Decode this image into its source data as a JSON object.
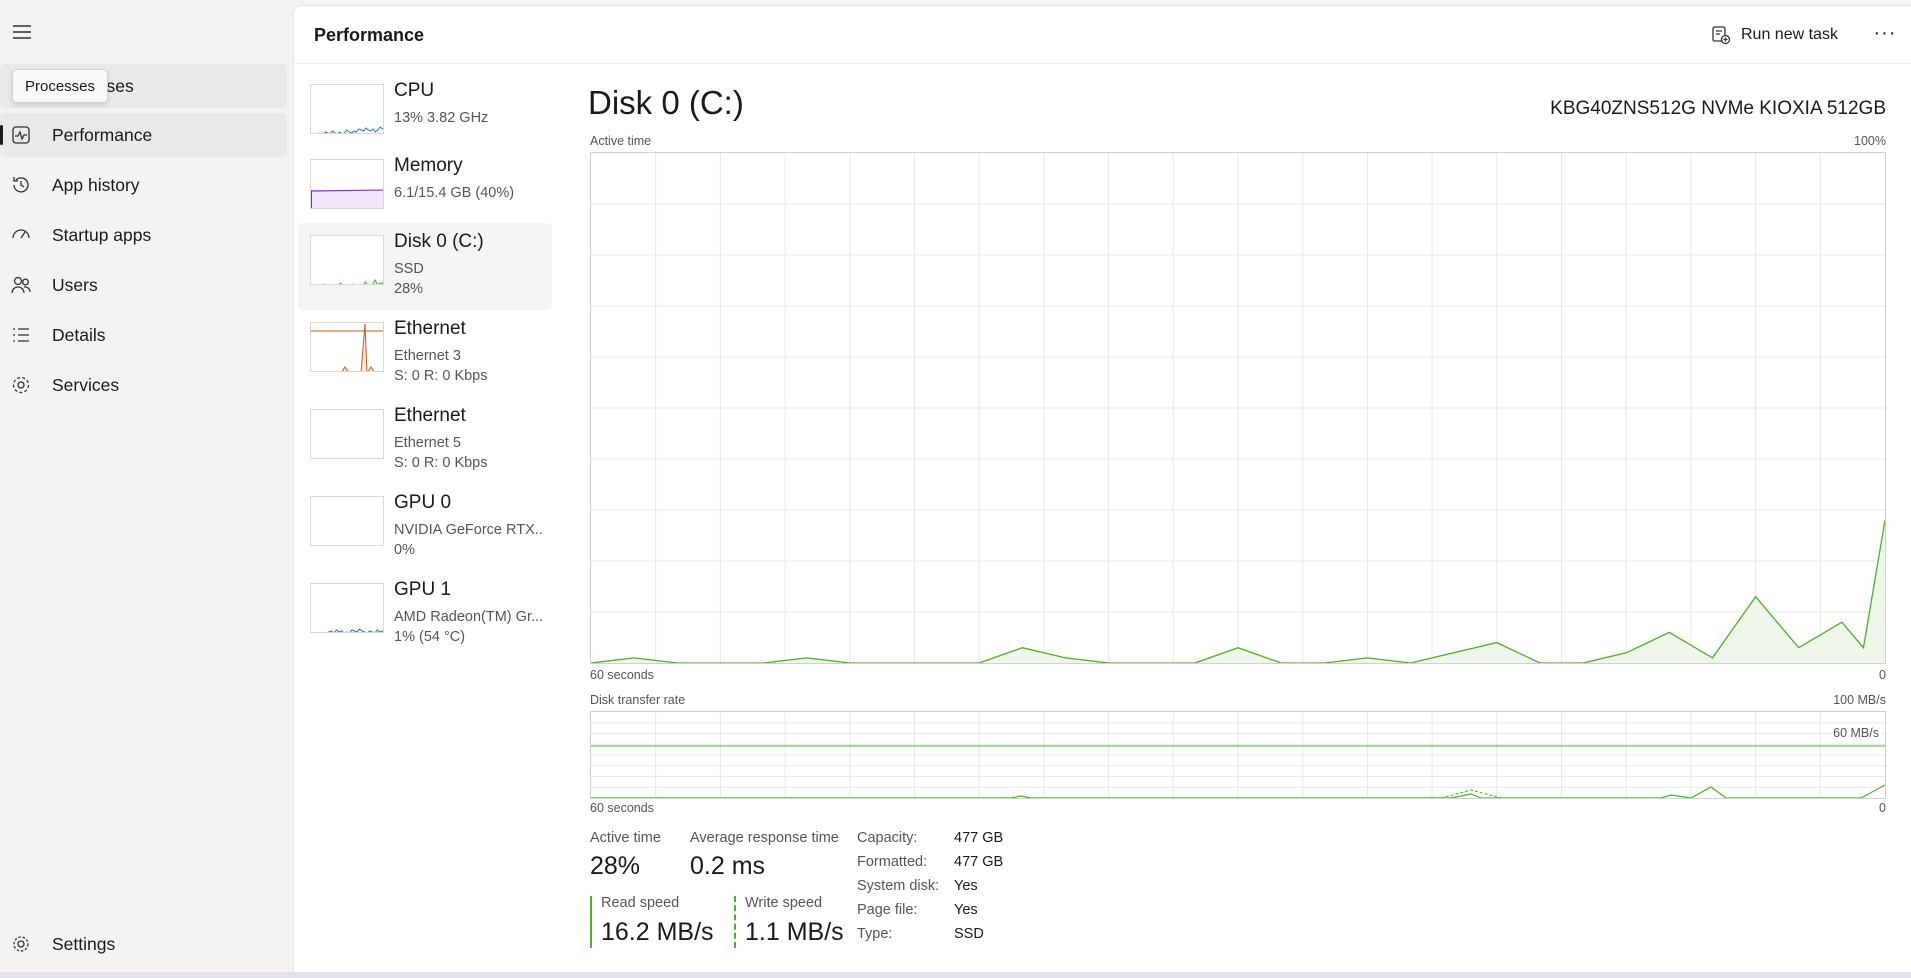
{
  "nav": {
    "tooltip": "Processes",
    "items": [
      {
        "label": "Processes",
        "icon": "processes-icon"
      },
      {
        "label": "Performance",
        "icon": "performance-icon"
      },
      {
        "label": "App history",
        "icon": "history-icon"
      },
      {
        "label": "Startup apps",
        "icon": "startup-icon"
      },
      {
        "label": "Users",
        "icon": "users-icon"
      },
      {
        "label": "Details",
        "icon": "details-icon"
      },
      {
        "label": "Services",
        "icon": "services-icon"
      }
    ],
    "settings": "Settings"
  },
  "header": {
    "title": "Performance",
    "run_task": "Run new task",
    "more": "···"
  },
  "devices": [
    {
      "name": "CPU",
      "sub1": "13%  3.82 GHz",
      "sub2": "",
      "color": "#1f78c8"
    },
    {
      "name": "Memory",
      "sub1": "6.1/15.4 GB (40%)",
      "sub2": "",
      "color": "#8a2be2"
    },
    {
      "name": "Disk 0 (C:)",
      "sub1": "SSD",
      "sub2": "28%",
      "color": "#4caf2a"
    },
    {
      "name": "Ethernet",
      "sub1": "Ethernet 3",
      "sub2": "S: 0  R: 0 Kbps",
      "color": "#c85a19"
    },
    {
      "name": "Ethernet",
      "sub1": "Ethernet 5",
      "sub2": "S: 0  R: 0 Kbps",
      "color": "#c85a19"
    },
    {
      "name": "GPU 0",
      "sub1": "NVIDIA GeForce RTX...",
      "sub2": "0%",
      "color": "#1f78c8"
    },
    {
      "name": "GPU 1",
      "sub1": "AMD Radeon(TM) Gr...",
      "sub2": "1% (54 °C)",
      "color": "#1f78c8"
    }
  ],
  "detail": {
    "title": "Disk 0 (C:)",
    "model": "KBG40ZNS512G NVMe KIOXIA 512GB",
    "active_chart": {
      "label": "Active time",
      "max": "100%",
      "left": "60 seconds",
      "right": "0"
    },
    "transfer_chart": {
      "label": "Disk transfer rate",
      "max": "100 MB/s",
      "marker": "60 MB/s",
      "left": "60 seconds",
      "right": "0"
    },
    "stats": {
      "active_time_label": "Active time",
      "active_time": "28%",
      "response_label": "Average response time",
      "response": "0.2 ms",
      "read_label": "Read speed",
      "read": "16.2 MB/s",
      "write_label": "Write speed",
      "write": "1.1 MB/s"
    },
    "props": [
      {
        "key": "Capacity:",
        "value": "477 GB"
      },
      {
        "key": "Formatted:",
        "value": "477 GB"
      },
      {
        "key": "System disk:",
        "value": "Yes"
      },
      {
        "key": "Page file:",
        "value": "Yes"
      },
      {
        "key": "Type:",
        "value": "SSD"
      }
    ]
  },
  "chart_data": {
    "type": "area",
    "title": "Active time",
    "x": [
      60,
      58,
      56,
      54,
      52,
      50,
      48,
      46,
      44,
      42,
      40,
      38,
      36,
      34,
      32,
      30,
      28,
      26,
      24,
      22,
      20,
      18,
      16,
      14,
      12,
      10,
      8,
      6,
      4,
      2,
      1,
      0
    ],
    "ylim": [
      0,
      100
    ],
    "series": [
      {
        "values": [
          0,
          1,
          0,
          0,
          0,
          1,
          0,
          0,
          0,
          0,
          3,
          1,
          0,
          0,
          0,
          3,
          0,
          0,
          1,
          0,
          2,
          4,
          0,
          0,
          2,
          6,
          1,
          13,
          3,
          8,
          3,
          28
        ]
      }
    ],
    "accent": "#4caf2a"
  }
}
